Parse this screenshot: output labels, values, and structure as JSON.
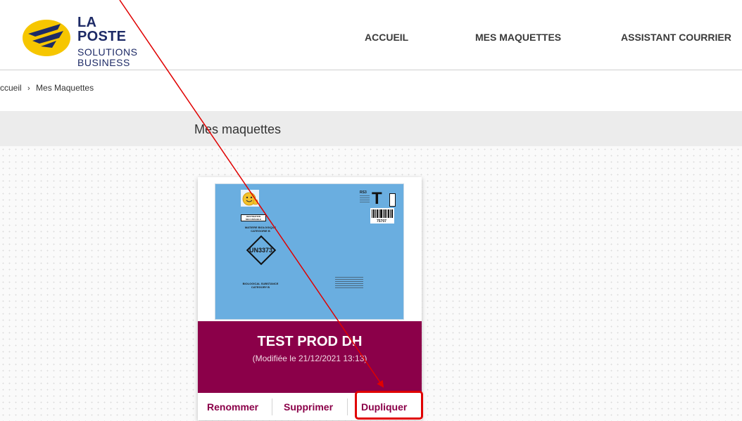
{
  "header": {
    "logo": {
      "line1": "LA POSTE",
      "line2": "SOLUTIONS",
      "line3": "BUSINESS"
    },
    "nav": [
      {
        "label": "ACCUEIL"
      },
      {
        "label": "MES MAQUETTES"
      },
      {
        "label": "ASSISTANT COURRIER"
      }
    ]
  },
  "breadcrumb": {
    "home": "ccueil",
    "separator": "›",
    "current": "Mes Maquettes"
  },
  "page": {
    "title": "Mes maquettes"
  },
  "card": {
    "name": "TEST PROD DH",
    "modified": "(Modifiée le 21/12/2021 13:13)",
    "actions": {
      "rename": "Renommer",
      "delete": "Supprimer",
      "duplicate": "Dupliquer"
    },
    "preview": {
      "hazard_code": "UN3373",
      "label_top": "MATIERE BIOLOGIQUE CATEGORIE B",
      "label_bottom": "BIOLOGICAL SUBSTANCE CATEGORY B",
      "mark_letter": "T",
      "barcode_number": "75707",
      "corner_text": "RS3",
      "box_text": "DESTINATION MECANISABLE"
    }
  },
  "colors": {
    "brand_primary": "#8b0049",
    "preview_bg": "#6aaee0",
    "annotation_red": "#e00000",
    "logo_navy": "#1d2a66",
    "logo_yellow": "#f6c600"
  },
  "icons": [
    "la-poste-logo-icon",
    "emoji-thumbs-up-icon",
    "barcode-icon",
    "breadcrumb-chevron-icon"
  ]
}
